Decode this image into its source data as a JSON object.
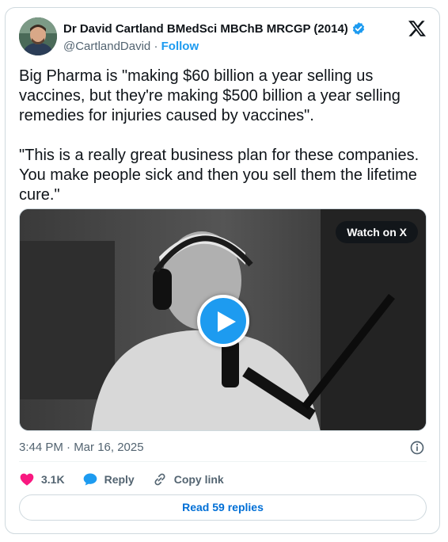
{
  "author": {
    "display_name": "Dr David Cartland BMedSci MBChB MRCGP (2014)",
    "handle": "@CartlandDavid",
    "separator": " · ",
    "follow_label": "Follow",
    "verified": true,
    "avatar_icon": "avatar-photo"
  },
  "platform": {
    "logo_icon": "x-logo-icon"
  },
  "tweet": {
    "paragraph1": "Big Pharma is \"making $60 billion a year selling us vaccines, but they're making $500 billion a year selling remedies for injuries caused by vaccines\".",
    "paragraph2": "\"This is a really great business plan for these companies. You make people sick and then you sell them the lifetime cure.\""
  },
  "video": {
    "watch_label": "Watch on X",
    "play_icon": "play-icon"
  },
  "meta": {
    "timestamp": "3:44 PM · Mar 16, 2025",
    "info_icon": "info-icon"
  },
  "actions": {
    "like_count": "3.1K",
    "reply_label": "Reply",
    "copy_label": "Copy link"
  },
  "footer": {
    "read_replies_label": "Read 59 replies"
  },
  "colors": {
    "accent": "#1d9bf0",
    "link": "#006fd6",
    "like": "#f91880",
    "muted": "#536471",
    "text": "#0f1419",
    "border": "#cfd9de"
  }
}
